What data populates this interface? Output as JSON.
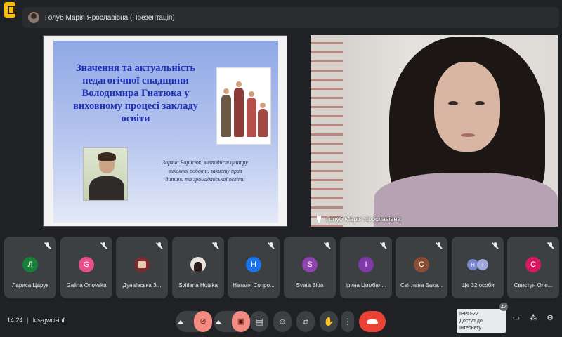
{
  "presenter_bar": {
    "title": "Голуб Марія Ярославівна (Презентація)"
  },
  "slide": {
    "title_lines": [
      "Значення та актуальність",
      "педагогічної спадщини",
      "Володимира Гнатюка у",
      "виховному процесі закладу",
      "освіти"
    ],
    "author_lines": [
      "Зоряна Борисюк, методист центру",
      "виховної роботи, захисту прав",
      "дитини та громадянської освіти"
    ]
  },
  "video": {
    "name": "Голуб Марія Ярославівна"
  },
  "participants": [
    {
      "name": "Лариса Царук",
      "initial": "Л",
      "color": "#188038",
      "kind": "letter"
    },
    {
      "name": "Galina Orlovska",
      "initial": "G",
      "color": "#e8508a",
      "kind": "letter"
    },
    {
      "name": "Дунаївська З...",
      "initial": "",
      "color": "#7b2a2e",
      "kind": "photo"
    },
    {
      "name": "Svitlana Hotska",
      "initial": "",
      "color": "#e9e3dc",
      "kind": "photo2"
    },
    {
      "name": "Наталя Сопро...",
      "initial": "Н",
      "color": "#1a73e8",
      "kind": "letter"
    },
    {
      "name": "Sveta Bida",
      "initial": "S",
      "color": "#8e44ad",
      "kind": "letter"
    },
    {
      "name": "Ірина Цимбал...",
      "initial": "І",
      "color": "#7e3aa8",
      "kind": "letter"
    },
    {
      "name": "Світлана Бака...",
      "initial": "С",
      "color": "#8a4d36",
      "kind": "letter"
    },
    {
      "name": "Ще 32 особи",
      "initial": "H I",
      "color": "#6b7bd6",
      "kind": "duo",
      "duo": [
        "H",
        "I"
      ],
      "duo_colors": [
        "#7986cb",
        "#9fa8da"
      ]
    },
    {
      "name": "Свистун Оле...",
      "initial": "С",
      "color": "#d81b60",
      "kind": "letter"
    }
  ],
  "bottom_bar": {
    "time": "14:24",
    "meeting_code": "kis-gwct-inf",
    "tooltip_line1": "IPPO-22",
    "tooltip_line2": "Доступ до Інтернету",
    "badge_count": "42"
  },
  "icons": {
    "mic": "mic-off-icon",
    "camera": "camera-off-icon",
    "captions": "captions-icon",
    "emoji": "emoji-icon",
    "present": "present-icon",
    "hand": "raise-hand-icon",
    "more": "more-options-icon",
    "end": "end-call-icon",
    "chat": "chat-icon",
    "activities": "activities-icon",
    "host": "host-controls-icon"
  },
  "colors": {
    "end_call": "#ea4335",
    "muted": "#f28b82",
    "accent": "#fbbc04"
  }
}
